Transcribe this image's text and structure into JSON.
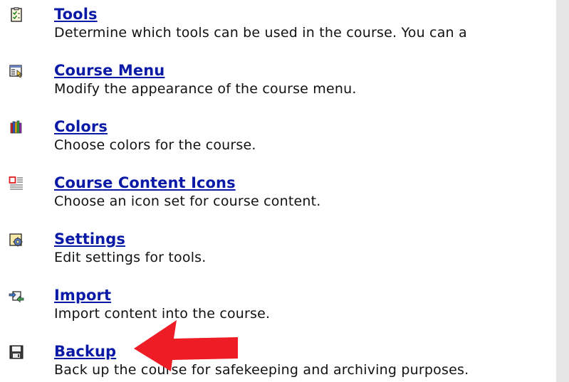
{
  "items": [
    {
      "title": "Tools",
      "description": "Determine which tools can be used in the course. You can a",
      "icon": "tools-checklist-icon"
    },
    {
      "title": "Course Menu",
      "description": "Modify the appearance of the course menu.",
      "icon": "course-menu-icon"
    },
    {
      "title": "Colors",
      "description": "Choose colors for the course.",
      "icon": "colors-crayons-icon"
    },
    {
      "title": "Course Content Icons",
      "description": "Choose an icon set for course content.",
      "icon": "content-icons-icon"
    },
    {
      "title": "Settings",
      "description": "Edit settings for tools.",
      "icon": "settings-gear-icon"
    },
    {
      "title": "Import",
      "description": "Import content into the course.",
      "icon": "import-arrows-icon"
    },
    {
      "title": "Backup",
      "description": "Back up the course for safekeeping and archiving purposes.",
      "icon": "backup-floppy-icon"
    }
  ],
  "colors": {
    "link": "#0a1aa6",
    "text": "#111111",
    "annotation_arrow": "#ee1c24",
    "scrollbar": "#e6e6e6"
  }
}
